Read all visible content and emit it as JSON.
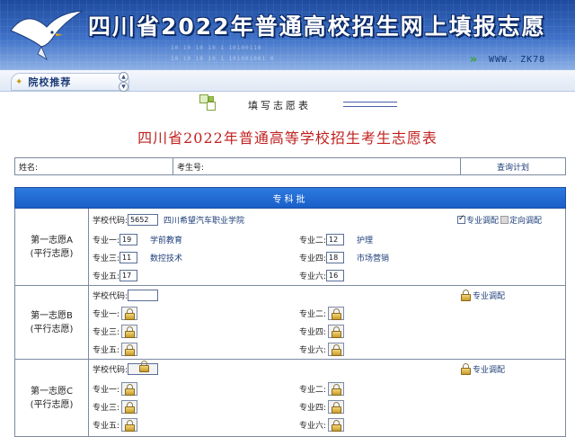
{
  "banner": {
    "title": "四川省2022年普通高校招生网上填报志愿",
    "url": "WWW. ZK78",
    "digits_a": "10 10 10 10 1 10100110",
    "digits_b": "10 10 10 10 1 101001001 0"
  },
  "nav": {
    "tab_label": "院校推荐"
  },
  "form": {
    "header": "填写志愿表",
    "title": "四川省2022年普通高等学校招生考生志愿表",
    "name_label": "姓名:",
    "exam_no_label": "考生号:",
    "query_plan": "查询计划",
    "batch": "专科批"
  },
  "labels": {
    "school_code": "学校代码:",
    "major1": "专业一:",
    "major2": "专业二:",
    "major3": "专业三:",
    "major4": "专业四:",
    "major5": "专业五:",
    "major6": "专业六:",
    "adjust_major": "专业调配",
    "adjust_direction": "定向调配"
  },
  "choices": [
    {
      "title": "第一志愿A",
      "sub": "(平行志愿)",
      "school_code": "5652",
      "school_name": "四川希望汽车职业学院",
      "majors": [
        {
          "code": "19",
          "name": "学前教育"
        },
        {
          "code": "12",
          "name": "护理"
        },
        {
          "code": "11",
          "name": "数控技术"
        },
        {
          "code": "18",
          "name": "市场营销"
        },
        {
          "code": "17",
          "name": ""
        },
        {
          "code": "16",
          "name": ""
        }
      ],
      "adjust_major_checked": true
    },
    {
      "title": "第一志愿B",
      "sub": "(平行志愿)"
    },
    {
      "title": "第一志愿C",
      "sub": "(平行志愿)"
    }
  ],
  "colors": {
    "batch_bar": "#1f68d4",
    "main_title": "#c0211f",
    "banner": "#2a5bb0"
  }
}
